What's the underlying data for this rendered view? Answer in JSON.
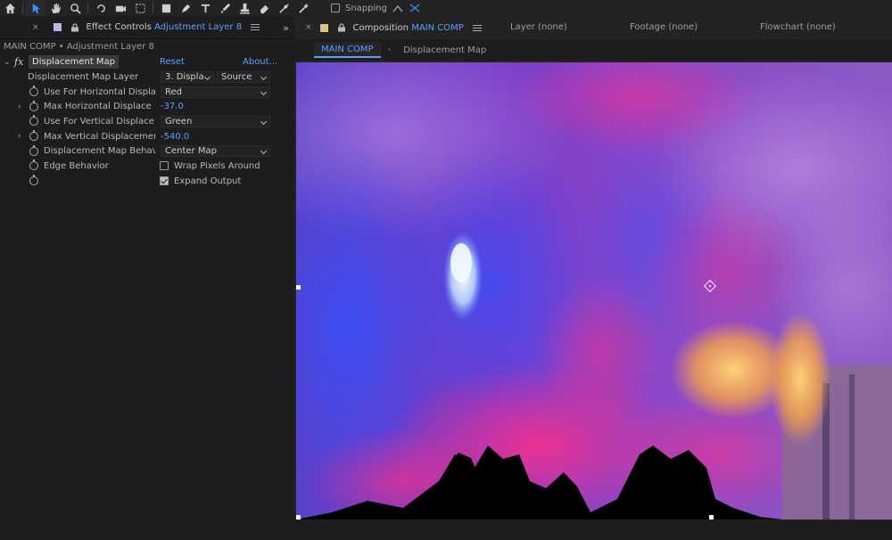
{
  "toolbar": {
    "snapping_label": "Snapping",
    "tools": [
      "home-icon",
      "selection-icon",
      "hand-icon",
      "zoom-icon",
      "rotate-icon",
      "camera-icon",
      "pan-behind-icon",
      "rectangle-icon",
      "pen-icon",
      "type-icon",
      "brush-icon",
      "clone-stamp-icon",
      "eraser-icon",
      "roto-brush-icon",
      "puppet-icon"
    ]
  },
  "effect_controls": {
    "tab_prefix": "Effect Controls",
    "tab_layer": "Adjustment Layer 8",
    "layer_path": "MAIN COMP • Adjustment Layer 8",
    "effect": {
      "name": "Displacement Map",
      "reset_label": "Reset",
      "about_label": "About..."
    },
    "props": {
      "map_layer": {
        "label": "Displacement Map Layer",
        "value": "3. Displa",
        "source": "Source"
      },
      "use_h": {
        "label": "Use For Horizontal Displa",
        "value": "Red"
      },
      "max_h": {
        "label": "Max Horizontal Displace",
        "value": "-37.0"
      },
      "use_v": {
        "label": "Use For Vertical Displace",
        "value": "Green"
      },
      "max_v": {
        "label": "Max Vertical Displacemen",
        "value": "-540.0"
      },
      "behavior": {
        "label": "Displacement Map Behav",
        "value": "Center Map"
      },
      "edge": {
        "label": "Edge Behavior",
        "wrap_label": "Wrap Pixels Around",
        "wrap_checked": false
      },
      "expand": {
        "label": "Expand Output",
        "checked": true
      }
    }
  },
  "composition": {
    "tab_prefix": "Composition",
    "tab_comp": "MAIN COMP",
    "other_tabs": [
      "Layer  (none)",
      "Footage  (none)",
      "Flowchart  (none)"
    ],
    "sub_tabs": {
      "active": "MAIN COMP",
      "other": "Displacement Map"
    }
  }
}
